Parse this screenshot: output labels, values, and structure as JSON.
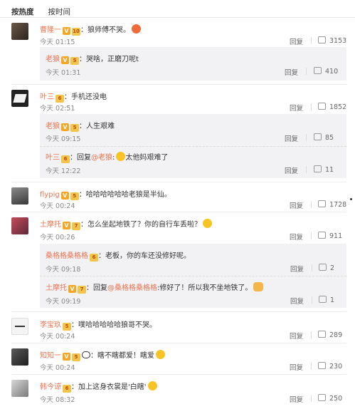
{
  "tabs": [
    "按热度",
    "按时间"
  ],
  "comments": [
    {
      "user": "曹隆一",
      "level": "10",
      "text": "：狼师傅不哭。",
      "emoji": "laugh-cry-emoji",
      "time": "今天 01:15",
      "reply": "回复",
      "likes": "3153",
      "replies": [
        {
          "user": "老狼",
          "level": "5",
          "text": "：哭啥，正磨刀呢t",
          "time": "今天 01:31",
          "reply": "回复",
          "likes": "410"
        }
      ]
    },
    {
      "user": "叶三",
      "level": "6",
      "text": "：手机还没电",
      "time": "今天 02:51",
      "reply": "回复",
      "likes": "1852",
      "replies": [
        {
          "user": "老狼",
          "level": "5",
          "text": "：人生艰难",
          "time": "今天 09:15",
          "reply": "回复",
          "likes": "85"
        },
        {
          "user": "叶三",
          "level": "6",
          "text": "：回复",
          "mention": "@老狼",
          "text2": ":",
          "emoji": "cry-emoji",
          "text3": "太他妈艰难了",
          "time": "今天 12:22",
          "reply": "回复",
          "likes": "11"
        }
      ]
    },
    {
      "user": "flypig",
      "level": "5",
      "text": "：哈哈哈哈哈哈老狼是半仙。",
      "time": "今天 00:24",
      "reply": "回复",
      "likes": "1728"
    },
    {
      "user": "土摩托",
      "level": "7",
      "text": "：怎么坐起地铁了？你的自行车丢啦？",
      "emoji": "think-emoji",
      "time": "今天 00:26",
      "reply": "回复",
      "likes": "911",
      "replies": [
        {
          "user": "桑格格桑格格",
          "level": "6",
          "text": "：老板，你的车还没修好呢。",
          "time": "今天 09:18",
          "reply": "回复",
          "likes": "2"
        },
        {
          "user": "土摩托",
          "level": "7",
          "text": "：回复",
          "mention": "@桑格格桑格格",
          "text2": ":修好了！所以我不坐地铁了。",
          "emoji": "strong-arm-emoji",
          "time": "今天 09:19",
          "reply": "回复",
          "likes": "1"
        }
      ]
    },
    {
      "user": "李宝玖",
      "level": "5",
      "text": "：噗哈哈哈哈哈狼哥不哭。",
      "time": "今天 00:24",
      "reply": "回复",
      "likes": "289"
    },
    {
      "user": "知知一",
      "level": "5",
      "text": "：瞎不瞎都爱！瞎爱",
      "emoji": "grin-emoji",
      "time": "今天 00:24",
      "reply": "回复",
      "likes": "230"
    },
    {
      "user": "韩今谅",
      "level": "6",
      "text": "：加上这身衣裳是'白瞎'",
      "emoji": "shock-emoji",
      "time": "今天 08:32",
      "reply": "回复",
      "likes": "250"
    }
  ]
}
